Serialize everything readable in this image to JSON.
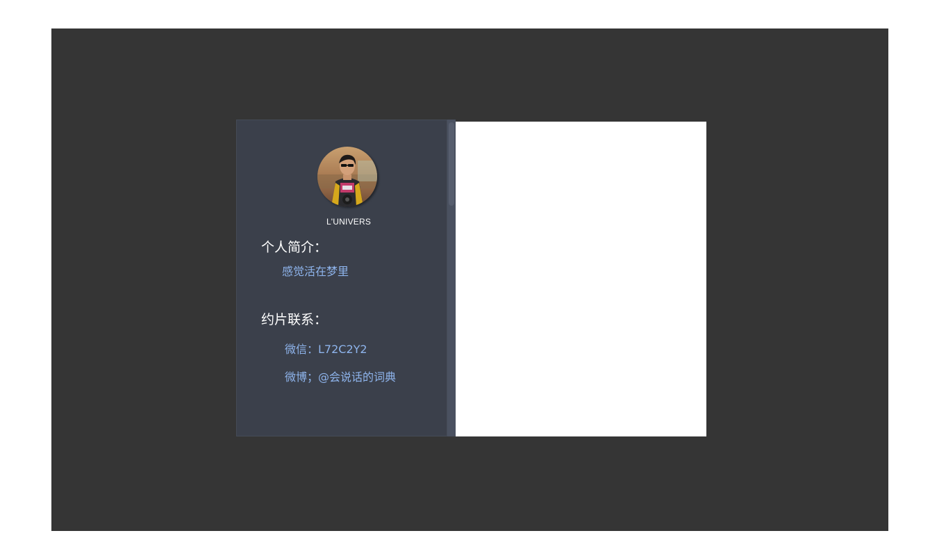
{
  "profile": {
    "username": "L'UNIVERS",
    "avatar_icon": "profile-photo"
  },
  "bio": {
    "title": "个人简介：",
    "text": "感觉活在梦里"
  },
  "contact": {
    "title": "约片联系：",
    "wechat": "微信：L72C2Y2",
    "weibo": "微博；@会说话的词典"
  },
  "colors": {
    "backdrop": "#353535",
    "sidebar": "#3b404b",
    "accent_text": "#8eb4ec",
    "content": "#ffffff"
  }
}
